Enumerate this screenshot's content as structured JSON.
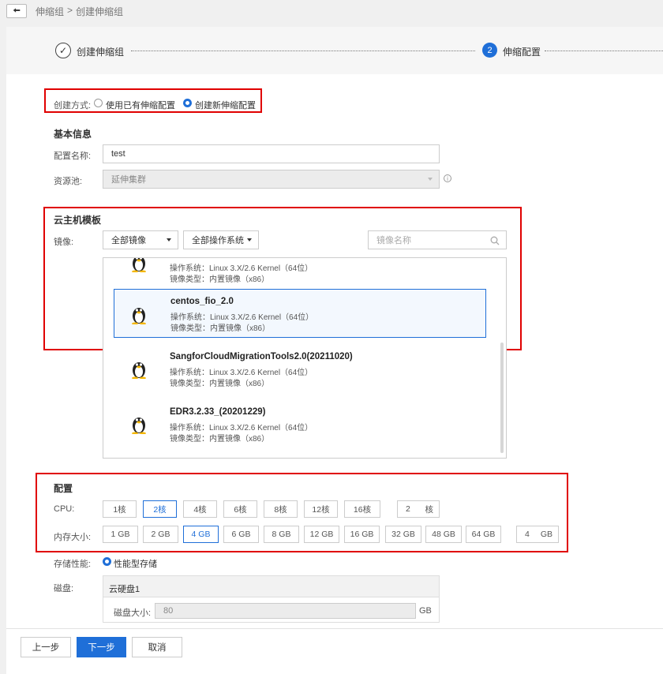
{
  "breadcrumb": {
    "root": "伸缩组",
    "sep": ">",
    "current": "创建伸缩组"
  },
  "steps": {
    "step1": "创建伸缩组",
    "step2_num": "2",
    "step2": "伸缩配置"
  },
  "creation": {
    "label": "创建方式:",
    "option_existing": "使用已有伸缩配置",
    "option_new": "创建新伸缩配置",
    "selected": "new"
  },
  "basic": {
    "title": "基本信息",
    "name_label": "配置名称:",
    "name_value": "test",
    "pool_label": "资源池:",
    "pool_value": "延伸集群"
  },
  "template": {
    "title": "云主机模板",
    "image_label": "镜像:",
    "image_filter": "全部镜像",
    "os_filter": "全部操作系统",
    "search_placeholder": "镜像名称",
    "images": [
      {
        "name": "",
        "os": "操作系统：Linux 3.X/2.6 Kernel（64位）",
        "type": "镜像类型：内置镜像（x86）"
      },
      {
        "name": "centos_fio_2.0",
        "os": "操作系统：Linux 3.X/2.6 Kernel（64位）",
        "type": "镜像类型：内置镜像（x86）"
      },
      {
        "name": "SangforCloudMigrationTools2.0(20211020)",
        "os": "操作系统：Linux 3.X/2.6 Kernel（64位）",
        "type": "镜像类型：内置镜像（x86）"
      },
      {
        "name": "EDR3.2.33_(20201229)",
        "os": "操作系统：Linux 3.X/2.6 Kernel（64位）",
        "type": "镜像类型：内置镜像（x86）"
      }
    ]
  },
  "config": {
    "title": "配置",
    "cpu_label": "CPU:",
    "cpu_options": [
      "1核",
      "2核",
      "4核",
      "6核",
      "8核",
      "12核",
      "16核"
    ],
    "cpu_selected": "2核",
    "cpu_custom_value": "2",
    "cpu_custom_unit": "核",
    "mem_label": "内存大小:",
    "mem_options": [
      "1 GB",
      "2 GB",
      "4 GB",
      "6 GB",
      "8 GB",
      "12 GB",
      "16 GB",
      "32 GB",
      "48 GB",
      "64 GB"
    ],
    "mem_selected": "4 GB",
    "mem_custom_value": "4",
    "mem_custom_unit": "GB"
  },
  "storage": {
    "label": "存储性能:",
    "option": "性能型存储",
    "disk_label": "磁盘:",
    "disk_name": "云硬盘1",
    "size_label": "磁盘大小:",
    "size_value": "80",
    "size_unit": "GB"
  },
  "footer": {
    "prev": "上一步",
    "next": "下一步",
    "cancel": "取消"
  },
  "colors": {
    "primary": "#1f6fd8",
    "highlight": "#e00000"
  }
}
